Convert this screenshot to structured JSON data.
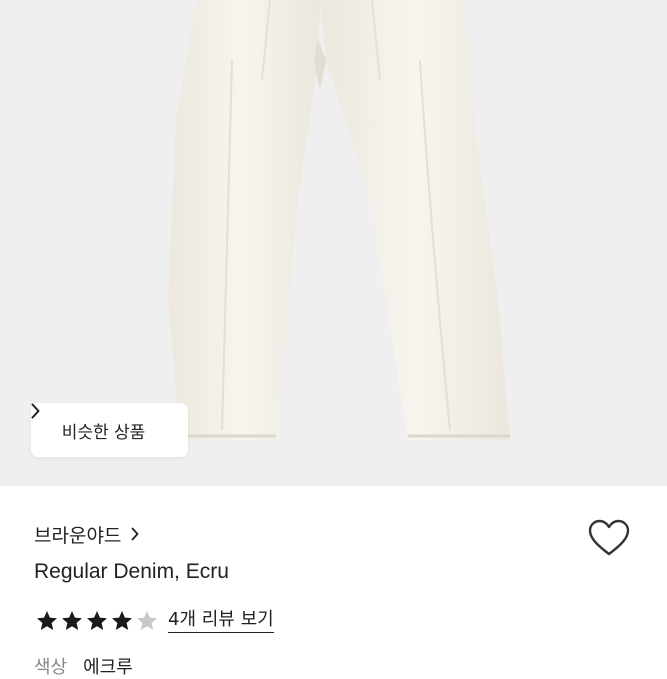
{
  "similar_button": {
    "label": "비슷한 상품"
  },
  "product": {
    "brand": "브라운야드",
    "title": "Regular Denim, Ecru",
    "rating": {
      "value": 4,
      "max": 5
    },
    "review_link": "4개 리뷰 보기",
    "color_label": "색상",
    "color_value": "에크루"
  },
  "icons": {
    "similar_chevron": "chevron-right-icon",
    "brand_chevron": "chevron-right-icon",
    "wishlist": "heart-outline-icon",
    "star_filled": "star-filled-icon",
    "star_empty": "star-empty-icon"
  },
  "colors": {
    "star_filled": "#1a1a1a",
    "star_empty": "#c8c8c8",
    "hero_bg": "#efefef"
  }
}
